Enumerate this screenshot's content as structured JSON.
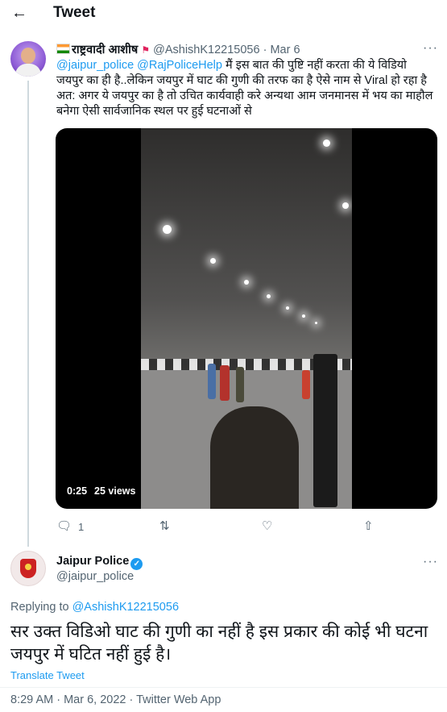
{
  "header": {
    "back_icon": "←",
    "title": "Tweet"
  },
  "tweet": {
    "display_name": "राष्ट्रवादी आशीष",
    "handle": "@AshishK12215056",
    "date": "Mar 6",
    "more": "···",
    "mention1": "@jaipur_police",
    "mention2": "@RajPoliceHelp",
    "text": "मैं इस बात की पुष्टि नहीं करता की ये विडियो जयपुर का ही है..लेकिन जयपुर में घाट की गुणी की तरफ का है ऐसे नाम से Viral हो रहा है अत: अगर ये जयपुर का है तो उचित कार्यवाही करे अन्यथा आम जनमानस में भय का माहौल बनेगा ऐसी सार्वजानिक स्थल पर हुई घटनाओं से",
    "video": {
      "duration": "0:25",
      "views": "25 views"
    },
    "actions": {
      "reply_count": "1"
    }
  },
  "reply_tweet": {
    "display_name": "Jaipur Police",
    "verified_icon": "✓",
    "handle": "@jaipur_police",
    "more": "···",
    "replying_prefix": "Replying to",
    "replying_to": "@AshishK12215056",
    "text": "सर उक्त विडिओ घाट की गुणी का नहीं है इस प्रकार की कोई भी घटना जयपुर में घटित नहीं हुई है।",
    "translate": "Translate Tweet",
    "timestamp": "8:29 AM · Mar 6, 2022 · Twitter Web App"
  }
}
